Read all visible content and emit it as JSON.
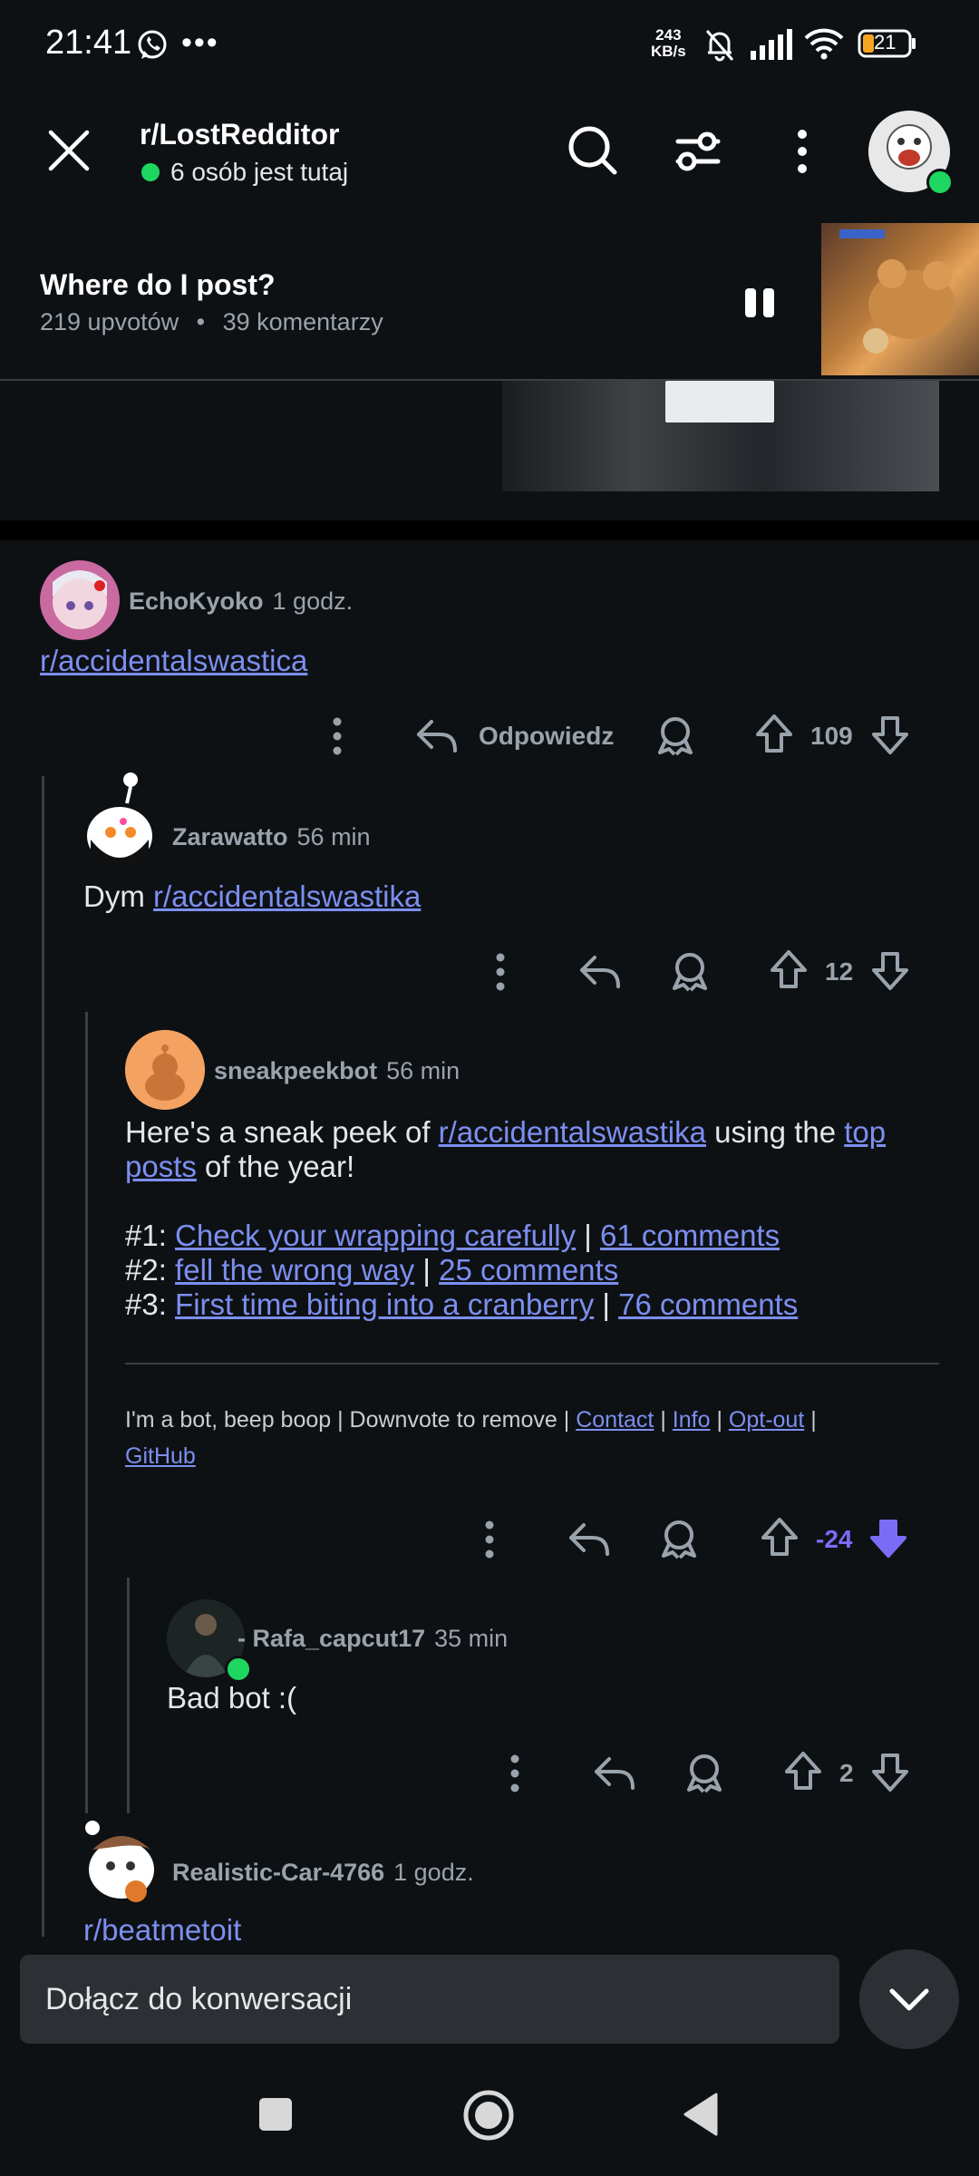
{
  "status_bar": {
    "time": "21:41",
    "more": "•••",
    "net_speed_value": "243",
    "net_speed_unit": "KB/s",
    "battery": "21"
  },
  "header": {
    "subreddit": "r/LostRedditor",
    "online": "6 osób jest tutaj"
  },
  "post": {
    "title": "Where do I post?",
    "upvotes": "219 upvotów",
    "separator": "•",
    "comments": "39 komentarzy"
  },
  "comments": [
    {
      "user": "EchoKyoko",
      "time": "1 godz.",
      "link": "r/accidentalswastica",
      "reply_label": "Odpowiedz",
      "score": "109"
    },
    {
      "user": "Zarawatto",
      "time": "56 min",
      "prefix": "Dym",
      "link": "r/accidentalswastika",
      "score": "12"
    },
    {
      "user": "sneakpeekbot",
      "time": "56 min",
      "intro_a": "Here's a sneak peek of",
      "intro_link": "r/accidentalswastika",
      "intro_b": "using the",
      "intro_link2a": "top",
      "intro_link2b": "posts",
      "intro_c": "of the year!",
      "top_posts": [
        {
          "rank": "#1:",
          "title": "Check your wrapping carefully",
          "sep": "|",
          "comments": "61 comments"
        },
        {
          "rank": "#2:",
          "title": "fell the wrong way",
          "sep": "|",
          "comments": "25 comments"
        },
        {
          "rank": "#3:",
          "title": "First time biting into a cranberry",
          "sep": "|",
          "comments": "76 comments"
        }
      ],
      "footer_text": "I'm a bot, beep boop | Downvote to remove |",
      "footer_links": [
        "Contact",
        "Info",
        "Opt-out",
        "GitHub"
      ],
      "footer_sep": "|",
      "score": "-24",
      "score_color": "#7b6cf6"
    },
    {
      "user": "Rafa_capcut17",
      "time": "35 min",
      "body": "Bad bot :(",
      "score": "2"
    },
    {
      "user": "Realistic-Car-4766",
      "time": "1 godz.",
      "link": "r/beatmetoit"
    }
  ],
  "composer": {
    "placeholder": "Dołącz do konwersacji"
  },
  "icons": [
    "whatsapp-icon",
    "mute-bell-icon",
    "signal-icon",
    "wifi-icon",
    "battery-icon",
    "close-icon",
    "search-icon",
    "filter-icon",
    "more-vert-icon",
    "pause-icon",
    "reply-icon",
    "award-icon",
    "upvote-icon",
    "downvote-icon",
    "chevron-down-icon",
    "recent-apps-icon",
    "home-icon",
    "back-icon"
  ],
  "colors": {
    "link": "#7c8ff0",
    "online": "#1ed760",
    "downvoted": "#7b6cf6"
  }
}
